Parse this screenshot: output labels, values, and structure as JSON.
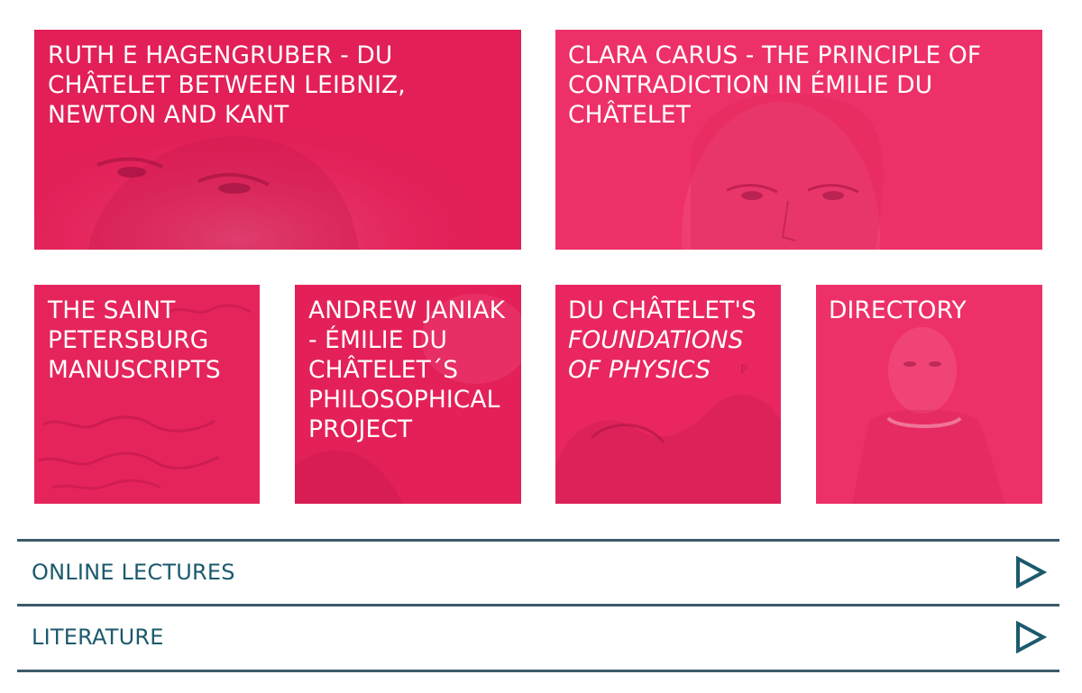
{
  "tiles": [
    {
      "title": "RUTH E HAGENGRUBER - DU CHÂTELET BETWEEN LEIBNIZ, NEWTON AND KANT"
    },
    {
      "title": "CLARA CARUS - THE PRINCIPLE OF CONTRADICTION IN ÉMILIE DU CHÂTELET"
    },
    {
      "title": "THE SAINT PETERSBURG MANUSCRIPTS"
    },
    {
      "title": "ANDREW JANIAK - ÉMILIE DU CHÂTELET´S PHILOSOPHICAL PROJECT"
    },
    {
      "title_prefix": "DU CHÂTELET'S",
      "title_italic": "FOUNDATIONS OF PHYSICS"
    },
    {
      "title": "DIRECTORY"
    }
  ],
  "accordion": [
    {
      "label": "ONLINE LECTURES",
      "icon": "play-triangle-icon"
    },
    {
      "label": "LITERATURE",
      "icon": "play-triangle-icon"
    }
  ],
  "colors": {
    "tile_pink": "#e8245f",
    "accent_teal": "#1b5a6e",
    "rule": "#3d5b6b"
  }
}
